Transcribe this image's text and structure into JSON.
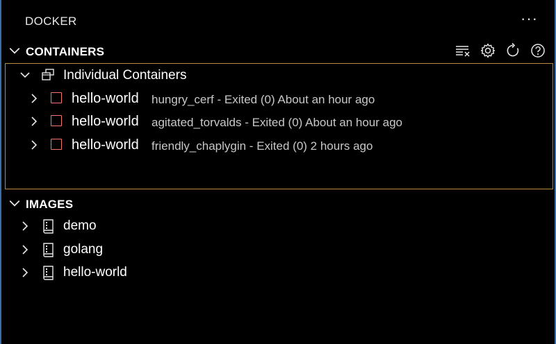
{
  "panel": {
    "title": "DOCKER",
    "more_label": "···"
  },
  "containers": {
    "title": "CONTAINERS",
    "actions": [
      "clear-icon",
      "gear-icon",
      "refresh-icon",
      "help-icon"
    ],
    "group": {
      "label": "Individual Containers"
    },
    "items": [
      {
        "name": "hello-world",
        "desc": "hungry_cerf - Exited (0) About an hour ago"
      },
      {
        "name": "hello-world",
        "desc": "agitated_torvalds - Exited (0) About an hour ago"
      },
      {
        "name": "hello-world",
        "desc": "friendly_chaplygin - Exited (0) 2 hours ago"
      }
    ]
  },
  "images": {
    "title": "IMAGES",
    "items": [
      {
        "label": "demo"
      },
      {
        "label": "golang"
      },
      {
        "label": "hello-world"
      }
    ]
  },
  "colors": {
    "background": "#000000",
    "panel_border": "#3a6ea5",
    "focus_border": "#b98a3c",
    "stopped_status": "#f4776a"
  }
}
